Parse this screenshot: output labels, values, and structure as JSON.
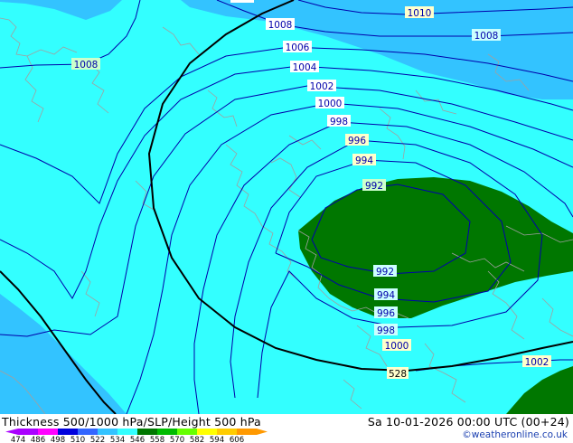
{
  "title": "Thickness 500/1000 hPa/SLP/Height 500 hPa",
  "valid_time": "Sa 10-01-2026 00:00 UTC (00+24)",
  "credit": "©weatheronline.co.uk",
  "colors": {
    "band_498_510": "#33c3ff",
    "band_510_522": "#33ffff",
    "band_534_546": "#007700",
    "isobar": "#0000aa",
    "height_contour": "#000000",
    "coastline": "#a0a0a0"
  },
  "legend": {
    "ticks": [
      "474",
      "486",
      "498",
      "510",
      "522",
      "534",
      "546",
      "558",
      "570",
      "582",
      "594",
      "606"
    ],
    "colors": [
      "#aa00ff",
      "#ff00ff",
      "#0000dd",
      "#3366ff",
      "#33c3ff",
      "#33ffff",
      "#007700",
      "#00bb00",
      "#66ff00",
      "#ffff00",
      "#ffcc00",
      "#ff9900"
    ]
  },
  "isobar_labels": {
    "l1008_top": "1008",
    "l1010": "1010",
    "l1008_right": "1008",
    "l1008_left": "1008",
    "l1006": "1006",
    "l1004": "1004",
    "l1002": "1002",
    "l1000": "1000",
    "l998": "998",
    "l996": "996",
    "l994": "994",
    "l992": "992",
    "l992_b": "992",
    "l994_b": "994",
    "l996_b": "996",
    "l998_b": "998",
    "l1000_b": "1000",
    "l1002_b": "1002"
  },
  "height_label": "528"
}
